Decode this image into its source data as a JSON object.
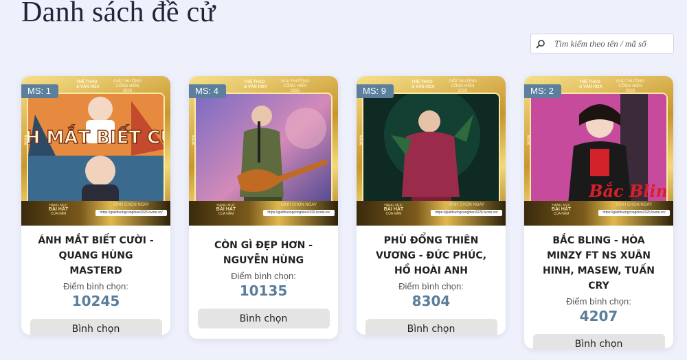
{
  "page": {
    "title": "Danh sách đề cử"
  },
  "search": {
    "placeholder": "Tìm kiếm theo tên / mã số"
  },
  "poster_common": {
    "brand_line1": "THỂ THAO",
    "brand_line2": "& VĂN HÓA",
    "edition_line1": "GIẢI THƯỞNG",
    "edition_line2": "CỐNG HIẾN",
    "edition_line3": "2026",
    "year": "2026",
    "category_small": "HẠNG MỤC",
    "category_big": "BÀI HÁT",
    "category_sub": "CỦA NĂM",
    "vote_now": "BÌNH CHỌN NGAY",
    "url": "https://giaithuongconghien2026.bvote.vn/"
  },
  "score_label": "Điểm bình chọn:",
  "vote_label": "Bình chọn",
  "cards": [
    {
      "badge": "MS: 1",
      "title": "ÁNH MẮT BIẾT CƯỜI - QUANG HÙNG MASTERD",
      "score": "10245",
      "poster_text": "ÁNH MẮT BIẾT CƯỜI"
    },
    {
      "badge": "MS: 4",
      "title": "CÒN GÌ ĐẸP HƠN - NGUYỄN HÙNG",
      "score": "10135"
    },
    {
      "badge": "MS: 9",
      "title": "PHÙ ĐỔNG THIÊN VƯƠNG - ĐỨC PHÚC, HỒ HOÀI ANH",
      "score": "8304"
    },
    {
      "badge": "MS: 2",
      "title": "BẮC BLING - HÒA MINZY FT NS XUÂN HINH, MASEW, TUẤN CRY",
      "score": "4207",
      "poster_text": "Bắc Bling"
    }
  ]
}
